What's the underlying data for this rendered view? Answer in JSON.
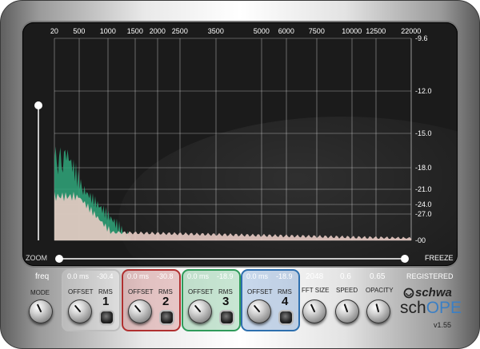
{
  "app": {
    "brand": "schwa",
    "product_prefix": "sch",
    "product_suffix": "OPE",
    "version": "v1.55",
    "registered": "REGISTERED"
  },
  "scope": {
    "freq_labels": [
      "20",
      "500",
      "1000",
      "1500",
      "2000",
      "2500",
      "3500",
      "5000",
      "6000",
      "7500",
      "10000",
      "12500",
      "22000"
    ],
    "freq_values": [
      20,
      500,
      1000,
      1500,
      2000,
      2500,
      3500,
      5000,
      6000,
      7500,
      10000,
      12500,
      22000
    ],
    "db_labels": [
      "-9.6",
      "-12.0",
      "-15.0",
      "-18.0",
      "-21.0",
      "-24.0",
      "-27.0",
      "-00"
    ],
    "zoom_label": "ZOOM",
    "freeze_label": "FREEZE",
    "vertical_zoom_level": 0.0,
    "horizontal_zoom_range": [
      0.0,
      1.0
    ],
    "colors": {
      "accent": "#2b9de4",
      "spectrum_green": "#2fa67a",
      "spectrum_pink": "#e8cbc4",
      "grid": "#cfcfcf"
    }
  },
  "controls": {
    "mode_label": "MODE",
    "mode_value": "freq",
    "offset_label": "OFFSET",
    "rms_label": "RMS",
    "channels": [
      {
        "number": "1",
        "offset": "0.0 ms",
        "rms": "-30.4",
        "color": "#bdbdbd"
      },
      {
        "number": "2",
        "offset": "0.0 ms",
        "rms": "-30.8",
        "color": "#b03030"
      },
      {
        "number": "3",
        "offset": "0.0 ms",
        "rms": "-18.9",
        "color": "#2f9a5a"
      },
      {
        "number": "4",
        "offset": "0.0 ms",
        "rms": "-18.9",
        "color": "#2d6fae"
      }
    ],
    "fft": {
      "label": "FFT SIZE",
      "value": "2048"
    },
    "speed": {
      "label": "SPEED",
      "value": "0.6"
    },
    "opacity": {
      "label": "OPACITY",
      "value": "0.65"
    }
  }
}
